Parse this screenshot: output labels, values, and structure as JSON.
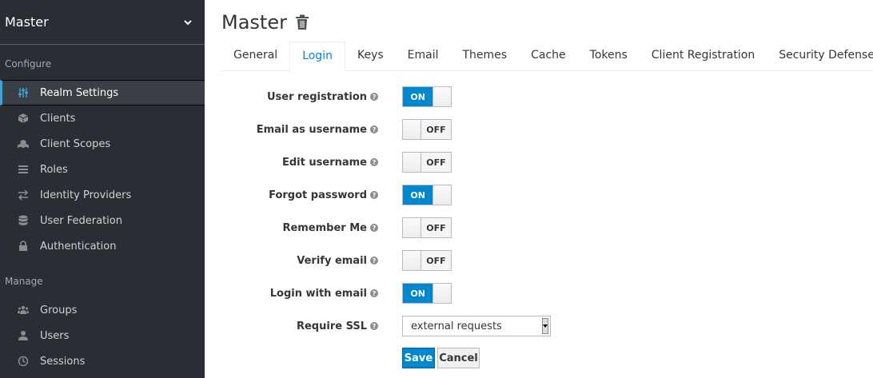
{
  "sidebar": {
    "realm": "Master",
    "configure_label": "Configure",
    "manage_label": "Manage",
    "configure_items": [
      {
        "label": "Realm Settings",
        "icon": "sliders-icon"
      },
      {
        "label": "Clients",
        "icon": "cube-icon"
      },
      {
        "label": "Client Scopes",
        "icon": "cubes-icon"
      },
      {
        "label": "Roles",
        "icon": "list-icon"
      },
      {
        "label": "Identity Providers",
        "icon": "exchange-icon"
      },
      {
        "label": "User Federation",
        "icon": "database-icon"
      },
      {
        "label": "Authentication",
        "icon": "lock-icon"
      }
    ],
    "manage_items": [
      {
        "label": "Groups",
        "icon": "users-icon"
      },
      {
        "label": "Users",
        "icon": "user-icon"
      },
      {
        "label": "Sessions",
        "icon": "clock-icon"
      }
    ]
  },
  "page": {
    "title": "Master"
  },
  "tabs": [
    "General",
    "Login",
    "Keys",
    "Email",
    "Themes",
    "Cache",
    "Tokens",
    "Client Registration",
    "Security Defenses"
  ],
  "active_tab": "Login",
  "settings": [
    {
      "label": "User registration",
      "value": "ON"
    },
    {
      "label": "Email as username",
      "value": "OFF"
    },
    {
      "label": "Edit username",
      "value": "OFF"
    },
    {
      "label": "Forgot password",
      "value": "ON"
    },
    {
      "label": "Remember Me",
      "value": "OFF"
    },
    {
      "label": "Verify email",
      "value": "OFF"
    },
    {
      "label": "Login with email",
      "value": "ON"
    }
  ],
  "require_ssl": {
    "label": "Require SSL",
    "value": "external requests"
  },
  "buttons": {
    "save": "Save",
    "cancel": "Cancel"
  },
  "colors": {
    "accent": "#0088ce",
    "sidebar_bg": "#292e34"
  }
}
